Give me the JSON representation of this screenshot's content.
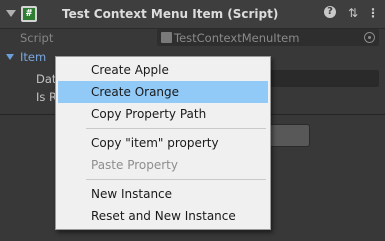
{
  "component_header": {
    "icon": "csharp-script-icon",
    "title": "Test Context Menu Item (Script)",
    "buttons": [
      "help-icon",
      "presets-icon",
      "more-icon"
    ]
  },
  "script_field": {
    "label": "Script",
    "value": "TestContextMenuItem"
  },
  "item_foldout": {
    "label": "Item"
  },
  "background_fields": {
    "data_label": "Dat",
    "is_r_label": "Is R"
  },
  "context_menu": {
    "items": [
      {
        "label": "Create Apple",
        "state": "normal"
      },
      {
        "label": "Create Orange",
        "state": "highlighted"
      },
      {
        "label": "Copy Property Path",
        "state": "normal"
      },
      {
        "label": "Copy \"item\" property",
        "state": "normal"
      },
      {
        "label": "Paste Property",
        "state": "disabled"
      },
      {
        "label": "New Instance",
        "state": "normal"
      },
      {
        "label": "Reset and New Instance",
        "state": "normal"
      }
    ]
  },
  "colors": {
    "menu_highlight": "#91c9f7",
    "inspector_background": "#383838",
    "foldout_label": "#79a8e0"
  }
}
